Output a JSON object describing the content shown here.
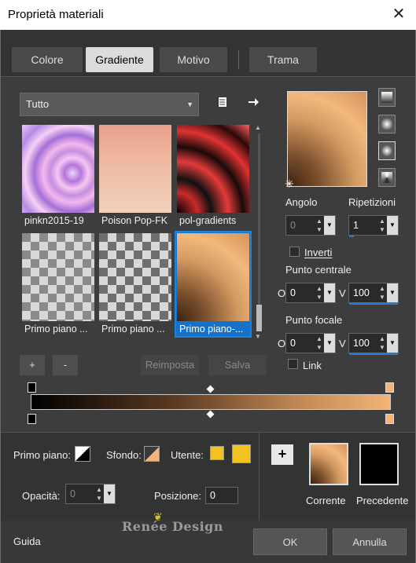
{
  "window": {
    "title": "Proprietà materiali",
    "close_glyph": "✕"
  },
  "tabs": [
    {
      "label": "Colore",
      "active": false
    },
    {
      "label": "Gradiente",
      "active": true
    },
    {
      "label": "Motivo",
      "active": false
    },
    {
      "label": "Trama",
      "active": false
    }
  ],
  "library": {
    "category_select": "Tutto",
    "items": [
      {
        "label": "pinkn2015-19"
      },
      {
        "label": "Poison Pop-FK"
      },
      {
        "label": "pol-gradients"
      },
      {
        "label": "Primo piano ..."
      },
      {
        "label": "Primo piano ..."
      },
      {
        "label": "Primo piano-...",
        "selected": true
      }
    ],
    "add_label": "+",
    "remove_label": "-",
    "reset_label": "Reimposta",
    "save_label": "Salva"
  },
  "gradient": {
    "angle_label": "Angolo",
    "angle_value": "0",
    "repeats_label": "Ripetizioni",
    "repeats_value": "1",
    "invert_label": "Inverti",
    "invert_checked": false,
    "center_label": "Punto centrale",
    "center_h_label": "O",
    "center_h_value": "0",
    "center_v_label": "V",
    "center_v_value": "100",
    "focal_label": "Punto focale",
    "focal_h_label": "O",
    "focal_h_value": "0",
    "focal_v_label": "V",
    "focal_v_value": "100",
    "link_label": "Link",
    "link_checked": false,
    "colors": {
      "start": "#000000",
      "end": "#f3b476"
    }
  },
  "stop_props": {
    "foreground_label": "Primo piano:",
    "background_label": "Sfondo:",
    "user_label": "Utente:",
    "user_color": "#f2c21e",
    "opacity_label": "Opacità:",
    "opacity_value": "0",
    "position_label": "Posizione:",
    "position_value": "0"
  },
  "compare": {
    "add_label": "+",
    "current_label": "Corrente",
    "previous_label": "Precedente"
  },
  "footer": {
    "help_label": "Guida",
    "ok_label": "OK",
    "cancel_label": "Annulla"
  },
  "watermark": {
    "text": "Renée Design"
  }
}
